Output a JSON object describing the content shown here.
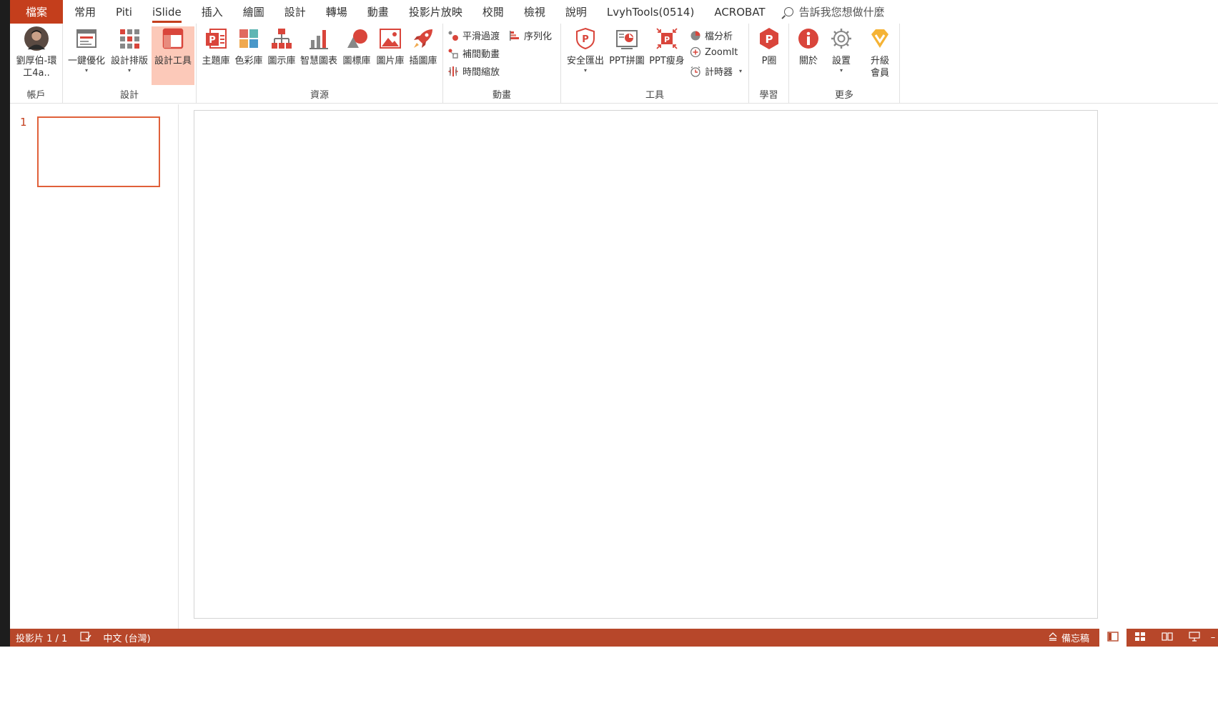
{
  "tabs": {
    "file": "檔案",
    "items": [
      "常用",
      "Piti",
      "iSlide",
      "插入",
      "繪圖",
      "設計",
      "轉場",
      "動畫",
      "投影片放映",
      "校閱",
      "檢視",
      "說明",
      "LvyhTools(0514)",
      "ACROBAT"
    ],
    "active": "iSlide",
    "tell_me": "告訴我您想做什麼"
  },
  "ribbon": {
    "account": {
      "user_line1": "劉厚伯-環",
      "user_line2": "工4a..",
      "label": "帳戶"
    },
    "design": {
      "one_key": "一鍵優化",
      "layout": "設計排版",
      "tools": "設計工具",
      "label": "設計"
    },
    "resources": {
      "theme": "主題庫",
      "color": "色彩庫",
      "diagram": "圖示庫",
      "chart": "智慧圖表",
      "icon": "圖標庫",
      "picture": "圖片庫",
      "illustration": "插圖庫",
      "label": "資源"
    },
    "animation": {
      "smooth": "平滑過渡",
      "serialize": "序列化",
      "tween": "補間動畫",
      "timescale": "時間縮放",
      "label": "動畫"
    },
    "tools": {
      "export": "安全匯出",
      "collage": "PPT拼圖",
      "slim": "PPT瘦身",
      "analysis": "檔分析",
      "zoomit": "ZoomIt",
      "timer": "計時器",
      "label": "工具"
    },
    "learn": {
      "p_circle": "P圈",
      "label": "學習"
    },
    "more": {
      "about": "關於",
      "settings": "設置",
      "upgrade_line1": "升級",
      "upgrade_line2": "會員",
      "label": "更多"
    }
  },
  "slides": {
    "number": "1"
  },
  "status": {
    "slide_info": "投影片 1 / 1",
    "language": "中文 (台灣)",
    "notes": "備忘稿"
  },
  "colors": {
    "accent": "#c43e1c",
    "statusbar": "#b7472a",
    "selected": "#fcc9b9"
  }
}
